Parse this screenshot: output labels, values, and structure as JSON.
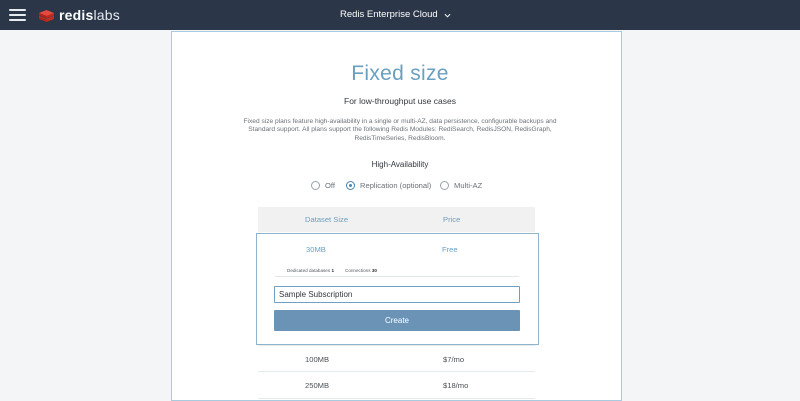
{
  "header": {
    "logo_bold": "redis",
    "logo_light": "labs",
    "product_name": "Redis Enterprise Cloud"
  },
  "plan": {
    "title": "Fixed size",
    "subtitle": "For low-throughput use cases",
    "description": "Fixed size plans feature high-availability in a single or multi-AZ, data persistence, configurable backups and Standard support. All plans support the following Redis Modules: RediSearch, RedisJSON, RedisGraph, RedisTimeSeries, RedisBloom."
  },
  "high_availability": {
    "label": "High-Availability",
    "options": [
      {
        "label": "Off",
        "checked": false
      },
      {
        "label": "Replication (optional)",
        "checked": true
      },
      {
        "label": "Multi-AZ",
        "checked": false
      }
    ]
  },
  "table": {
    "headers": {
      "size": "Dataset Size",
      "price": "Price"
    },
    "selected": {
      "size": "30MB",
      "price": "Free",
      "dedicated_label": "Dedicated databases",
      "dedicated_value": "1",
      "connections_label": "Connections",
      "connections_value": "30",
      "subscription_name": "Sample Subscription",
      "create_label": "Create"
    },
    "rows": [
      {
        "size": "100MB",
        "price": "$7/mo"
      },
      {
        "size": "250MB",
        "price": "$18/mo"
      }
    ]
  },
  "colors": {
    "topbar": "#2b3748",
    "accent": "#6a9fc0",
    "button": "#6b93b6",
    "logo_red": "#d82c20"
  }
}
